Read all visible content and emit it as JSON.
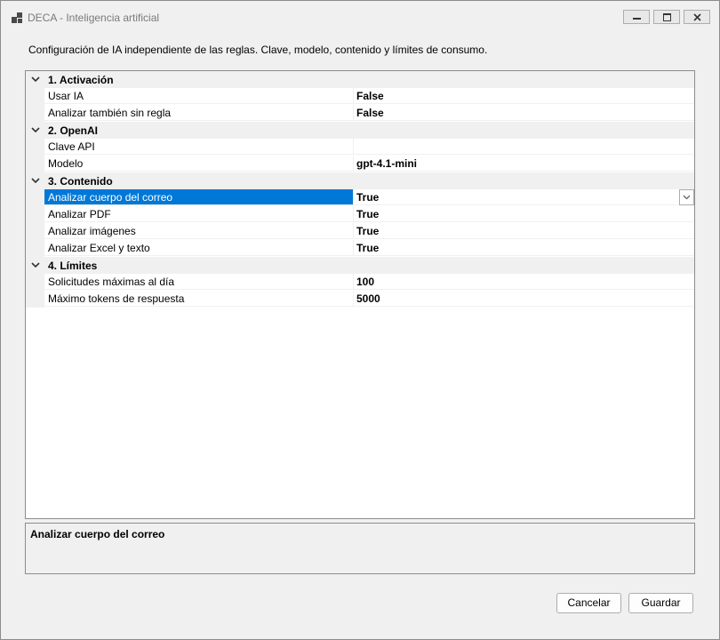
{
  "window": {
    "title": "DECA - Inteligencia artificial"
  },
  "description": "Configuración de IA independiente de las reglas. Clave, modelo, contenido y límites de consumo.",
  "grid": {
    "categories": [
      {
        "label": "1. Activación",
        "props": [
          {
            "name": "Usar IA",
            "value": "False"
          },
          {
            "name": "Analizar también sin regla",
            "value": "False"
          }
        ]
      },
      {
        "label": "2. OpenAI",
        "props": [
          {
            "name": "Clave API",
            "value": ""
          },
          {
            "name": "Modelo",
            "value": "gpt-4.1-mini"
          }
        ]
      },
      {
        "label": "3. Contenido",
        "props": [
          {
            "name": "Analizar cuerpo del correo",
            "value": "True"
          },
          {
            "name": "Analizar PDF",
            "value": "True"
          },
          {
            "name": "Analizar imágenes",
            "value": "True"
          },
          {
            "name": "Analizar Excel y texto",
            "value": "True"
          }
        ]
      },
      {
        "label": "4. Límites",
        "props": [
          {
            "name": "Solicitudes máximas al día",
            "value": "100"
          },
          {
            "name": "Máximo tokens de respuesta",
            "value": "5000"
          }
        ]
      }
    ],
    "selected": "Analizar cuerpo del correo"
  },
  "help": {
    "title": "Analizar cuerpo del correo"
  },
  "buttons": {
    "cancel": "Cancelar",
    "save": "Guardar"
  },
  "colors": {
    "selection": "#0078d7",
    "category_bg": "#f0f0f0"
  },
  "icons": {
    "chevron": "chevron-down-icon",
    "dropdown": "dropdown-arrow-icon"
  }
}
